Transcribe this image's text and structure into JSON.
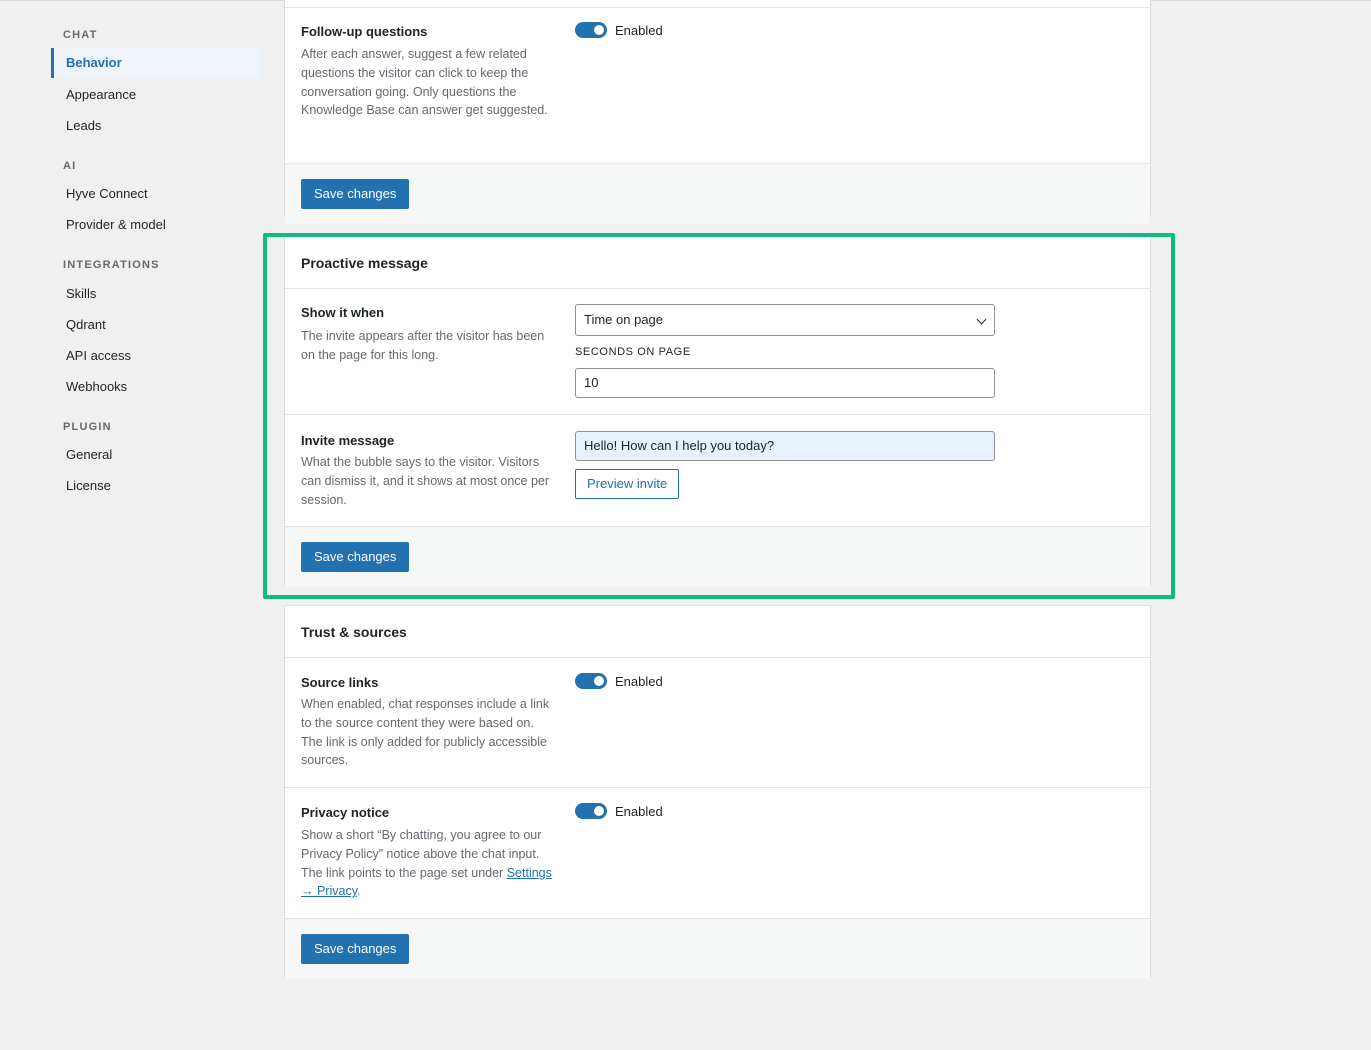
{
  "sidebar": {
    "sections": [
      {
        "heading": "CHAT",
        "items": [
          "Behavior",
          "Appearance",
          "Leads"
        ]
      },
      {
        "heading": "AI",
        "items": [
          "Hyve Connect",
          "Provider & model"
        ]
      },
      {
        "heading": "INTEGRATIONS",
        "items": [
          "Skills",
          "Qdrant",
          "API access",
          "Webhooks"
        ]
      },
      {
        "heading": "PLUGIN",
        "items": [
          "General",
          "License"
        ]
      }
    ],
    "active": "Behavior"
  },
  "followup": {
    "label": "Follow-up questions",
    "desc": "After each answer, suggest a few related questions the visitor can click to keep the conversation going. Only questions the Knowledge Base can answer get suggested.",
    "toggle_label": "Enabled",
    "save_label": "Save changes"
  },
  "proactive": {
    "title": "Proactive message",
    "show_label": "Show it when",
    "show_desc": "The invite appears after the visitor has been on the page for this long.",
    "trigger_value": "Time on page",
    "seconds_label": "SECONDS ON PAGE",
    "seconds_value": "10",
    "invite_label": "Invite message",
    "invite_desc": "What the bubble says to the visitor. Visitors can dismiss it, and it shows at most once per session.",
    "invite_value": "Hello! How can I help you today?",
    "preview_label": "Preview invite",
    "save_label": "Save changes"
  },
  "trust": {
    "title": "Trust & sources",
    "source_label": "Source links",
    "source_desc": "When enabled, chat responses include a link to the source content they were based on. The link is only added for publicly accessible sources.",
    "source_toggle": "Enabled",
    "privacy_label": "Privacy notice",
    "privacy_desc_before": "Show a short “By chatting, you agree to our Privacy Policy” notice above the chat input. The link points to the page set under ",
    "privacy_link": "Settings → Privacy",
    "privacy_desc_after": ".",
    "privacy_toggle": "Enabled",
    "save_label": "Save changes"
  },
  "colors": {
    "accent": "#2271b1",
    "highlight": "#12b886"
  }
}
